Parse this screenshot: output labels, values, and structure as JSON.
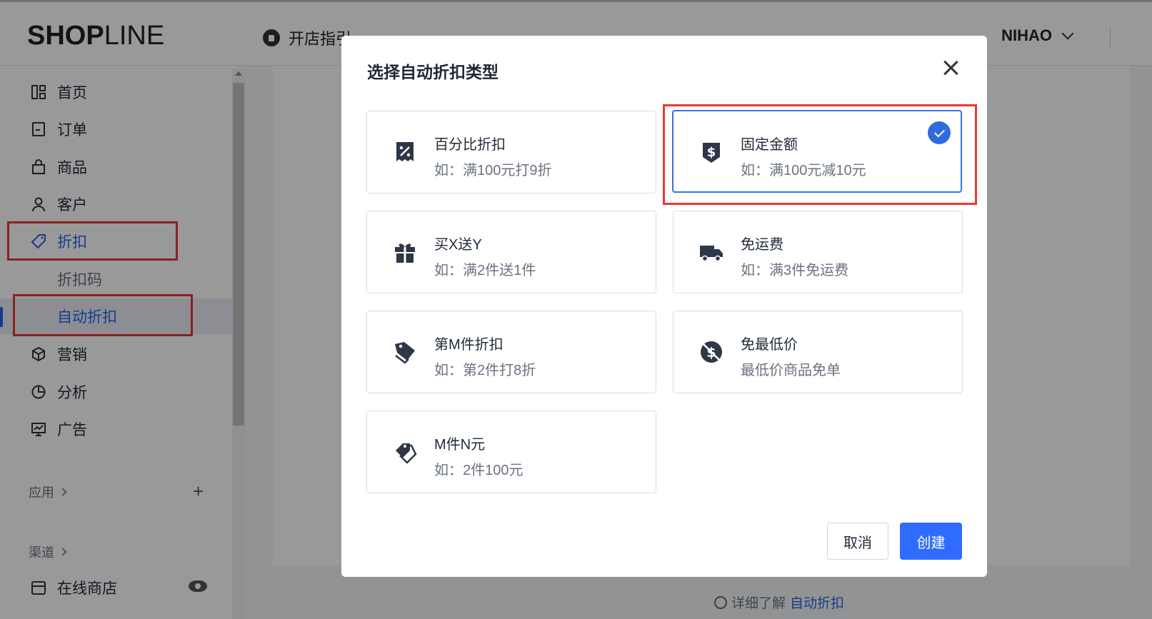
{
  "header": {
    "logo_bold": "SHOP",
    "logo_thin": "LINE",
    "guide_label": "开店指引",
    "user_name": "NIHAO"
  },
  "sidebar": {
    "items": [
      {
        "label": "首页",
        "icon": "dashboard-icon"
      },
      {
        "label": "订单",
        "icon": "order-icon"
      },
      {
        "label": "商品",
        "icon": "shopping-bag-icon"
      },
      {
        "label": "客户",
        "icon": "user-icon"
      },
      {
        "label": "折扣",
        "icon": "tag-icon"
      },
      {
        "label": "折扣码",
        "icon": ""
      },
      {
        "label": "自动折扣",
        "icon": ""
      },
      {
        "label": "营销",
        "icon": "cube-icon"
      },
      {
        "label": "分析",
        "icon": "pie-chart-icon"
      },
      {
        "label": "广告",
        "icon": "monitor-chart-icon"
      }
    ],
    "apps_label": "应用",
    "channels_label": "渠道",
    "online_store_label": "在线商店"
  },
  "background_help": {
    "prefix": "详细了解",
    "link": "自动折扣"
  },
  "modal": {
    "title": "选择自动折扣类型",
    "options": [
      {
        "title": "百分比折扣",
        "desc": "如：满100元打9折",
        "icon": "percent-receipt-icon"
      },
      {
        "title": "固定金额",
        "desc": "如：满100元减10元",
        "icon": "dollar-shield-icon",
        "selected": true
      },
      {
        "title": "买X送Y",
        "desc": "如：满2件送1件",
        "icon": "gift-icon"
      },
      {
        "title": "免运费",
        "desc": "如：满3件免运费",
        "icon": "truck-icon"
      },
      {
        "title": "第M件折扣",
        "desc": "如：第2件打8折",
        "icon": "tag-stack-icon"
      },
      {
        "title": "免最低价",
        "desc": "最低价商品免单",
        "icon": "dollar-off-icon"
      },
      {
        "title": "M件N元",
        "desc": "如：2件100元",
        "icon": "tags-icon"
      }
    ],
    "cancel_label": "取消",
    "create_label": "创建"
  },
  "colors": {
    "accent": "#2f6bff",
    "highlight_red": "#e53935",
    "selected_bg": "#e9edf7"
  }
}
